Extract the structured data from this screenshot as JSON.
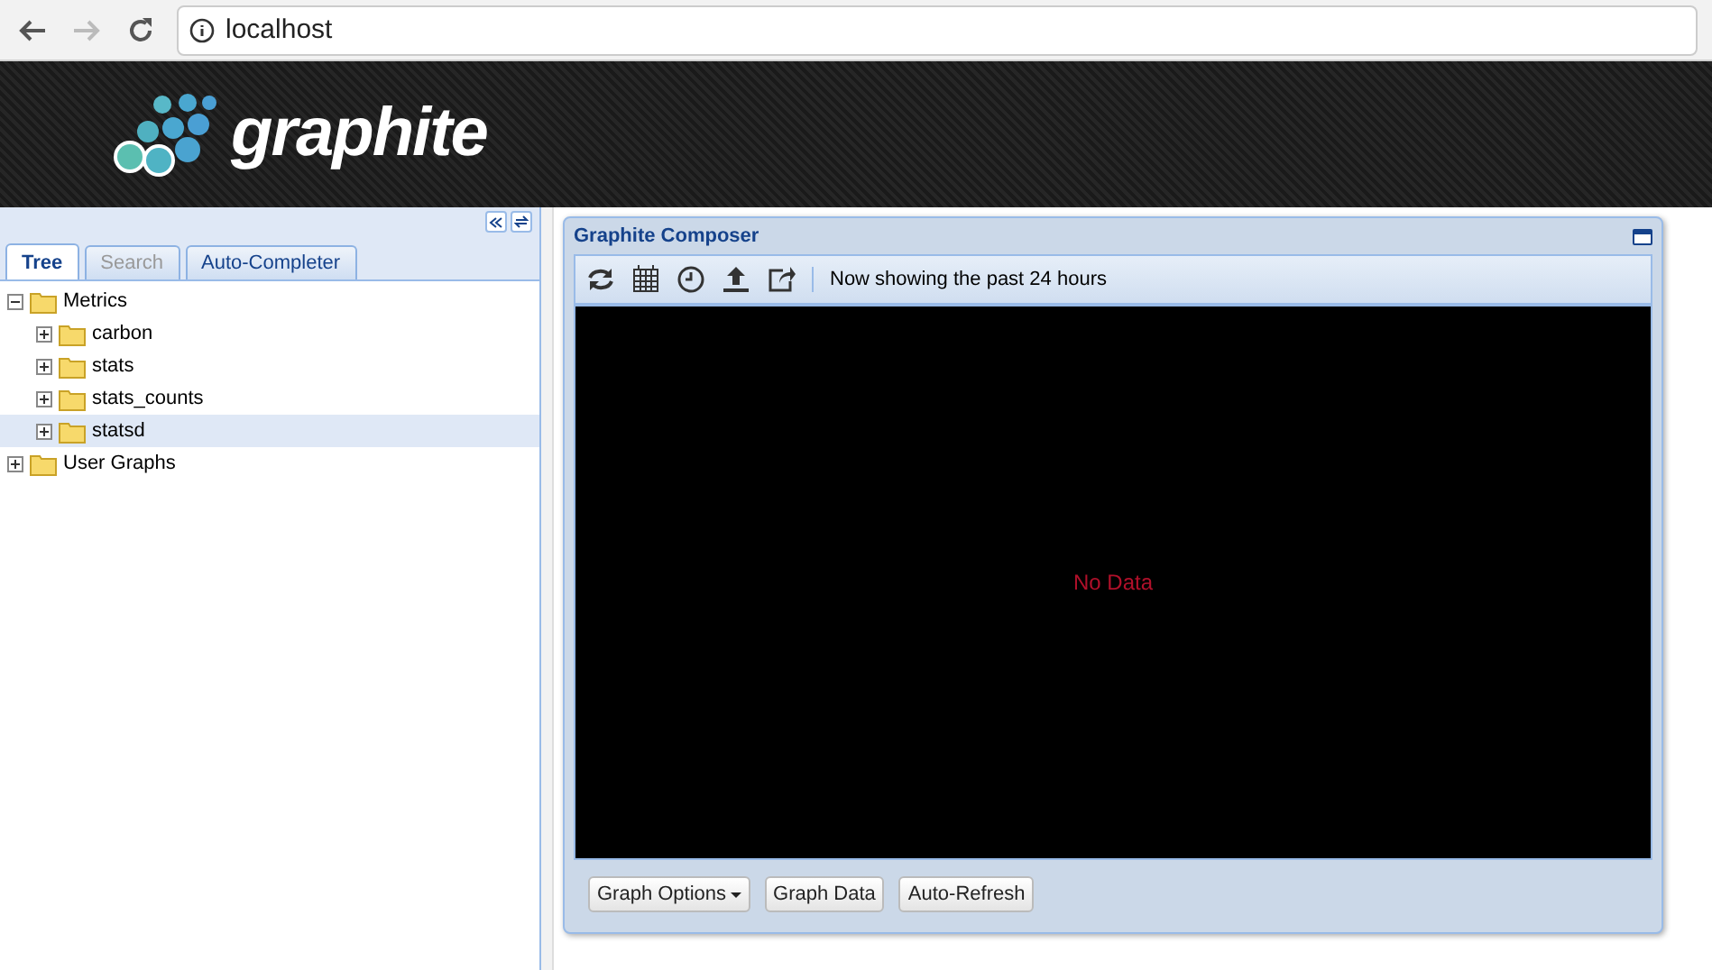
{
  "browser": {
    "url": "localhost"
  },
  "header": {
    "logo_text": "graphite"
  },
  "tabs": [
    {
      "label": "Tree",
      "selected": true,
      "disabled": false
    },
    {
      "label": "Search",
      "selected": false,
      "disabled": true
    },
    {
      "label": "Auto-Completer",
      "selected": false,
      "disabled": false
    }
  ],
  "tree": [
    {
      "label": "Metrics",
      "expanded": true,
      "selected": false,
      "children": [
        {
          "label": "carbon",
          "expanded": false,
          "selected": false
        },
        {
          "label": "stats",
          "expanded": false,
          "selected": false
        },
        {
          "label": "stats_counts",
          "expanded": false,
          "selected": false
        },
        {
          "label": "statsd",
          "expanded": false,
          "selected": true
        }
      ]
    },
    {
      "label": "User Graphs",
      "expanded": false,
      "selected": false
    }
  ],
  "composer": {
    "title": "Graphite Composer",
    "status": "Now showing the past 24 hours",
    "graph_message": "No Data",
    "buttons": [
      {
        "label": "Graph Options",
        "kind": "menu"
      },
      {
        "label": "Graph Data",
        "kind": "plain"
      },
      {
        "label": "Auto-Refresh",
        "kind": "plain"
      }
    ]
  }
}
